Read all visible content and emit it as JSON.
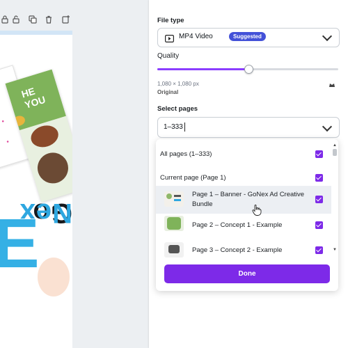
{
  "panel": {
    "file_type_label": "File type",
    "file_type_value": "MP4 Video",
    "file_type_badge": "Suggested",
    "quality_label": "Quality",
    "quality_level": 0.5,
    "dimensions": "1,080 × 1,080 px",
    "original_label": "Original",
    "select_pages_label": "Select pages",
    "select_pages_value": "1–333"
  },
  "dropdown": {
    "items": [
      {
        "label": "All pages (1–333)",
        "checked": true
      },
      {
        "label": "Current page (Page 1)",
        "checked": true
      },
      {
        "label": "Page 1 – Banner - GoNex Ad Creative Bundle",
        "checked": true
      },
      {
        "label": "Page 2 – Concept 1 - Example",
        "checked": true
      },
      {
        "label": "Page 3 – Concept 2 - Example",
        "checked": true
      }
    ],
    "done_label": "Done"
  },
  "canvas": {
    "brand_part1": "Go",
    "brand_part2": "Nex",
    "big_letter": "E",
    "card_title": "HE\nYOU"
  },
  "colors": {
    "accent": "#7d2ae8",
    "badge": "#4351d8",
    "brand_blue": "#2ea7e0"
  }
}
